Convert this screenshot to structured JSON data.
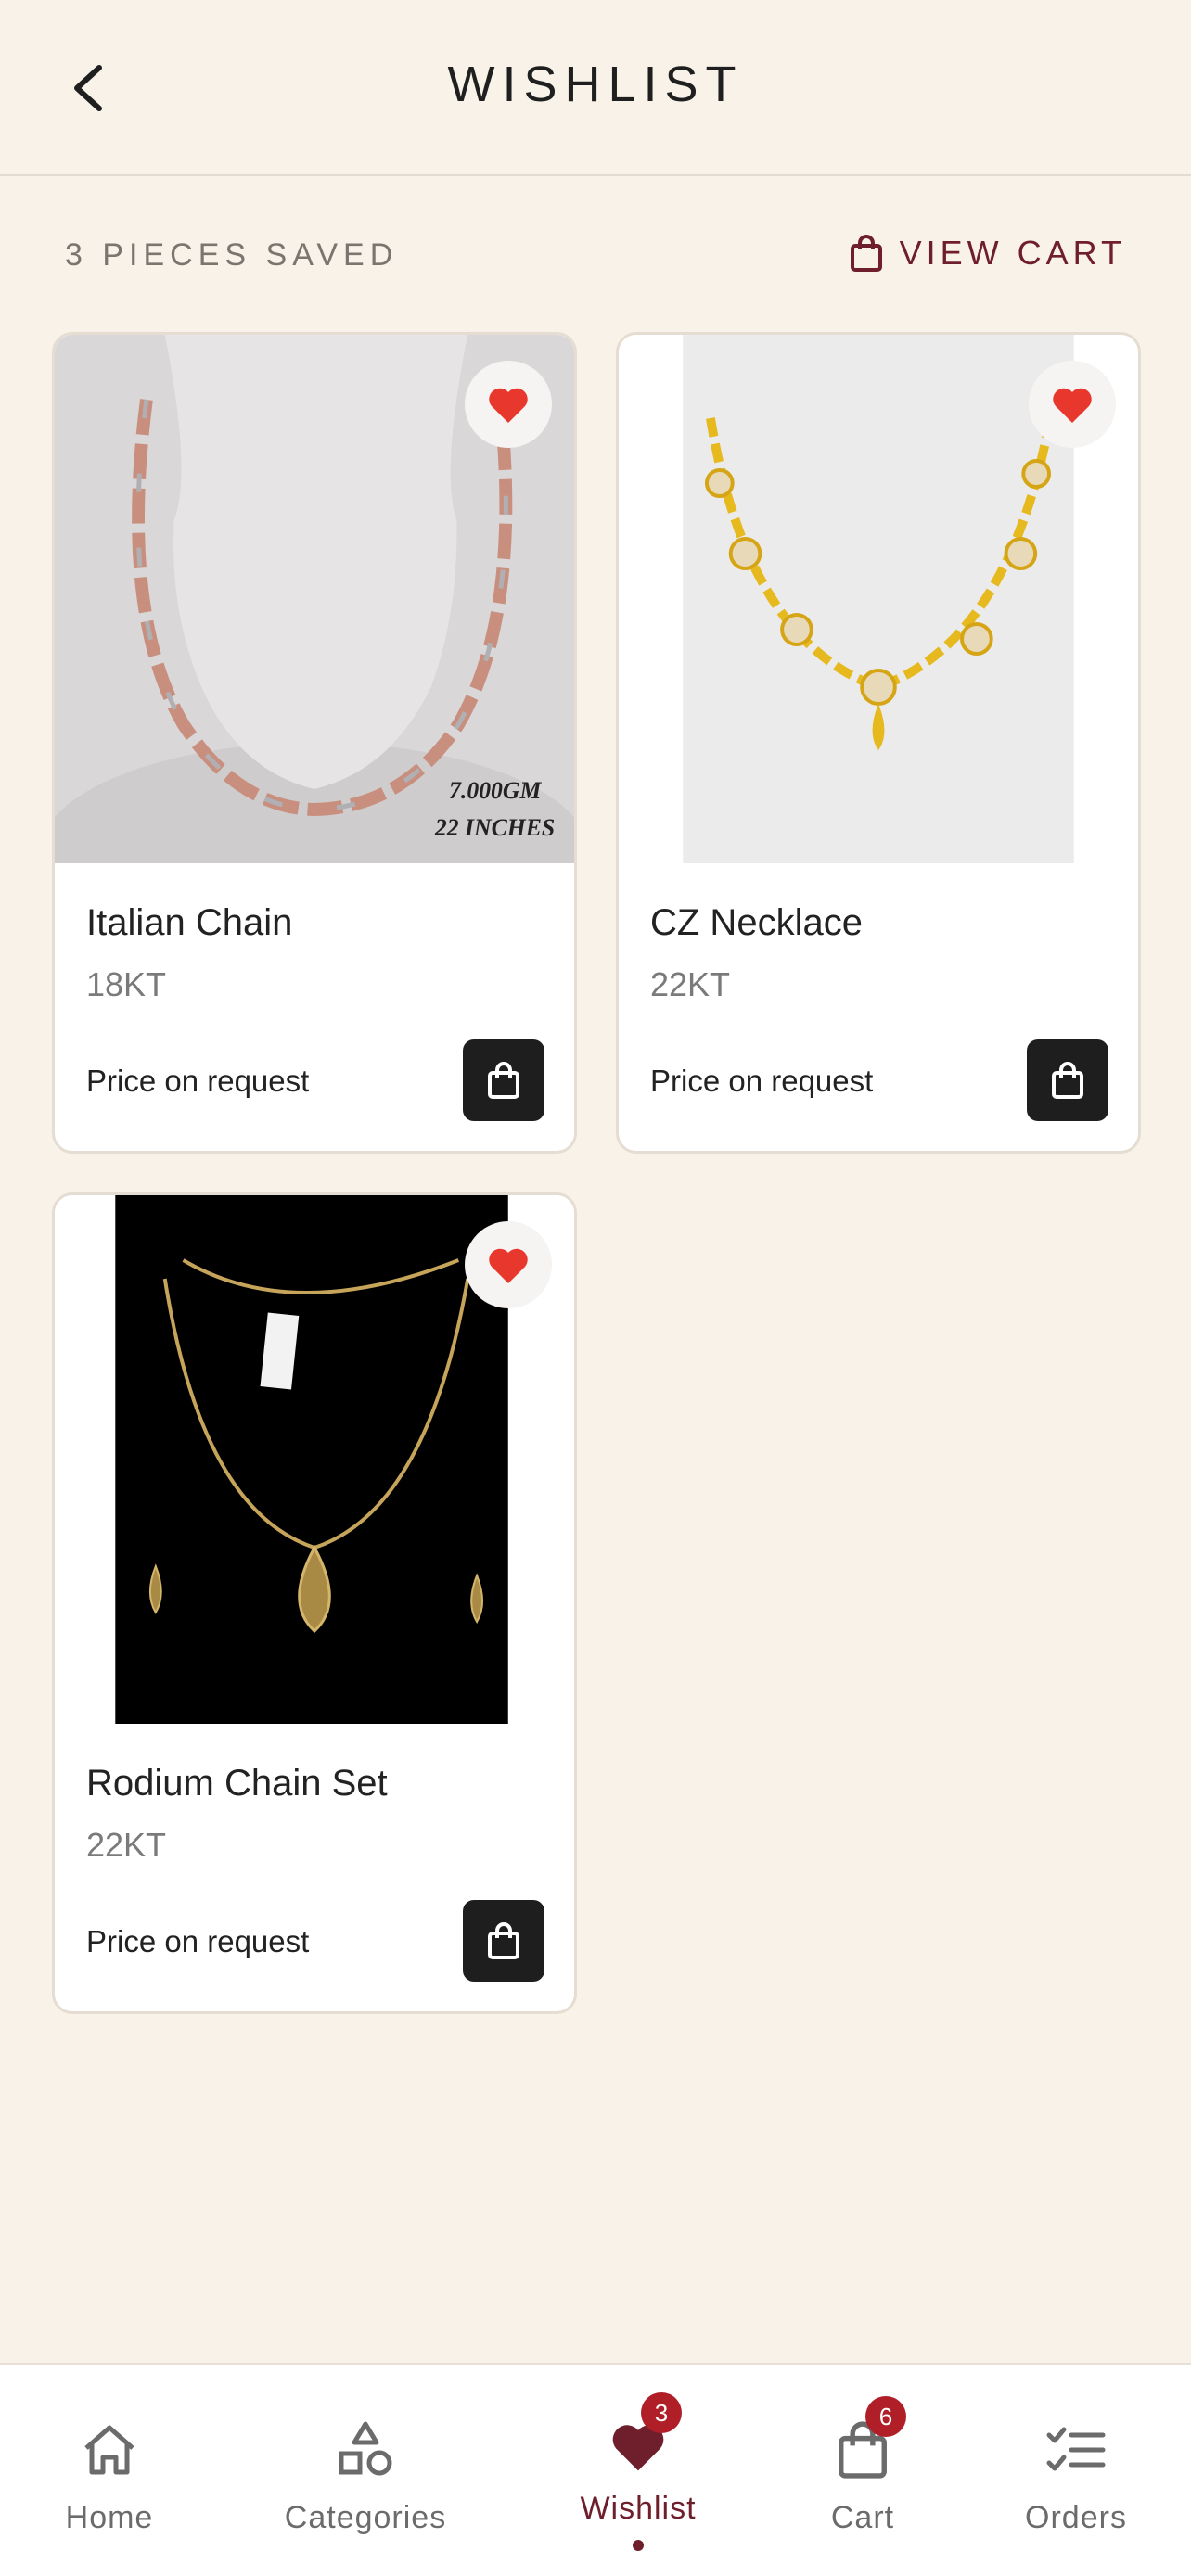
{
  "header": {
    "title": "WISHLIST",
    "back_icon": "chevron-left-icon"
  },
  "summary": {
    "saved_count": "3 PIECES SAVED",
    "view_cart_label": "VIEW CART"
  },
  "products": [
    {
      "name": "Italian Chain",
      "karat": "18KT",
      "price": "Price on request",
      "image_overlay_weight": "7.000GM",
      "image_overlay_length": "22 INCHES",
      "favorited": true
    },
    {
      "name": "CZ Necklace",
      "karat": "22KT",
      "price": "Price on request",
      "favorited": true
    },
    {
      "name": "Rodium Chain Set",
      "karat": "22KT",
      "price": "Price on request",
      "favorited": true
    }
  ],
  "nav": {
    "items": [
      {
        "label": "Home",
        "icon": "home-icon"
      },
      {
        "label": "Categories",
        "icon": "shapes-icon"
      },
      {
        "label": "Wishlist",
        "icon": "heart-icon",
        "badge": "3",
        "active": true
      },
      {
        "label": "Cart",
        "icon": "shopping-bag-icon",
        "badge": "6"
      },
      {
        "label": "Orders",
        "icon": "checklist-icon"
      }
    ]
  },
  "colors": {
    "background": "#f8f2e8",
    "accent": "#6e1f2b",
    "heart": "#e8372c",
    "badge": "#b01f28"
  }
}
